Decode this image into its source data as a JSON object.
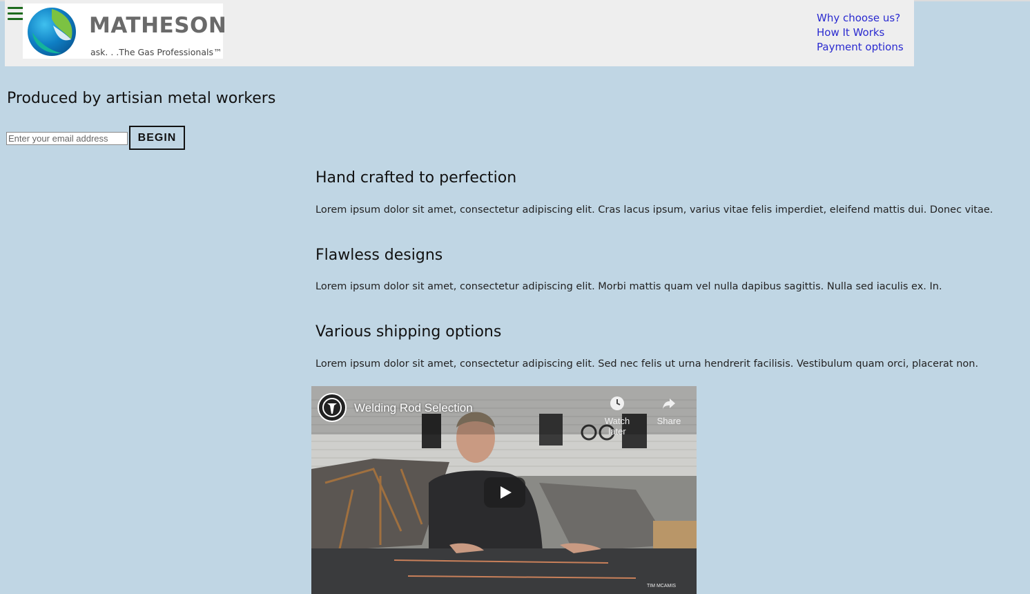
{
  "header": {
    "logo": {
      "brand": "MATHESON",
      "tagline": "ask. . .The Gas Professionals™"
    },
    "nav": [
      "Why choose us?",
      "How It Works",
      "Payment options"
    ]
  },
  "hero": {
    "title": "Produced by artisian metal workers",
    "email_placeholder": "Enter your email address",
    "email_value": "",
    "begin_label": "BEGIN"
  },
  "features": [
    {
      "title": "Hand crafted to perfection",
      "text": "Lorem ipsum dolor sit amet, consectetur adipiscing elit. Cras lacus ipsum, varius vitae felis imperdiet, eleifend mattis dui. Donec vitae."
    },
    {
      "title": "Flawless designs",
      "text": "Lorem ipsum dolor sit amet, consectetur adipiscing elit. Morbi mattis quam vel nulla dapibus sagittis. Nulla sed iaculis ex. In."
    },
    {
      "title": "Various shipping options",
      "text": "Lorem ipsum dolor sit amet, consectetur adipiscing elit. Sed nec felis ut urna hendrerit facilisis. Vestibulum quam orci, placerat non."
    }
  ],
  "video": {
    "title": "Welding Rod Selection",
    "watch_later": "Watch later",
    "share": "Share",
    "watermark": "TIM MCAMIS"
  },
  "colors": {
    "background": "#c0d6e4",
    "header_bg": "#eeeeee",
    "nav_link": "#2a2ad0",
    "hamburger": "#1d6b1d",
    "logo_text": "#6a6a6a"
  },
  "icons": [
    "hamburger-menu-icon",
    "globe-logo-icon",
    "clock-icon",
    "share-arrow-icon",
    "play-icon"
  ]
}
